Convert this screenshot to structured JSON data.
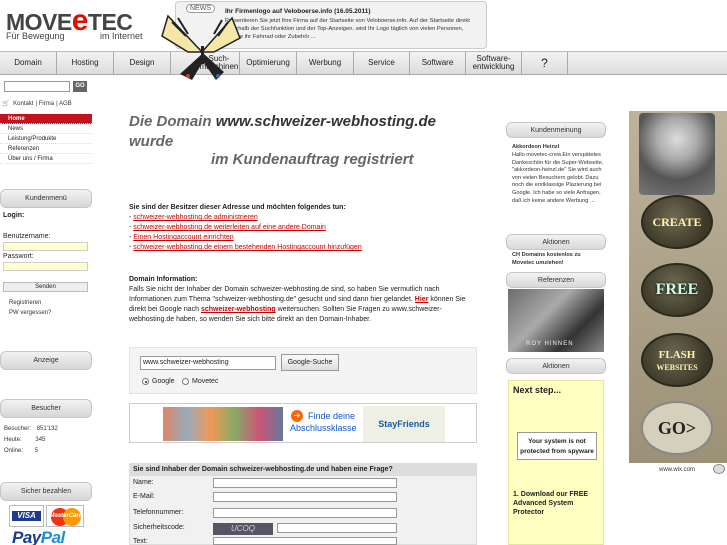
{
  "header": {
    "logo_main": "MOVE",
    "logo_e": "e",
    "logo_tec": "TEC",
    "logo_sub1": "Für Bewegung",
    "logo_sub2": "im Internet",
    "news_badge": "NEWS",
    "news_title": "Ihr Firmenlogo auf Veloboerse.info (16.05.2011)",
    "news_text": "Präsentieren Sie jetzt Ihre Firma auf der Startseite von Veloboerse.info. Auf der Startseite direkt unterhalb der Suchfunktion und der Top-Anzeigen. wird Ihr Logo täglich von vielen Personen, welche ihr Fahrrad oder Zubehör ..."
  },
  "nav": [
    "Domain",
    "Hosting",
    "Design",
    "Such-\nmaschinen",
    "Optimierung",
    "Werbung",
    "Service",
    "Software",
    "Software-\nentwicklung",
    "?"
  ],
  "left": {
    "go_label": "GO",
    "cart_links": [
      "Kontakt",
      "Firma",
      "AGB"
    ],
    "menu": [
      "Home",
      "News",
      "Leistung/Produkte",
      "Referenzen",
      "Über uns / Firma"
    ],
    "kundenmenu_title": "Kundenmenü",
    "login_label": "Login:",
    "username_label": "Benutzername:",
    "password_label": "Passwort:",
    "send_label": "Senden",
    "register_label": "Registrieren",
    "forgot_label": "PW vergessen?",
    "anzeige_title": "Anzeige",
    "besucher_title": "Besucher",
    "stats": [
      {
        "label": "Besucher:",
        "value": "851'132"
      },
      {
        "label": "Heute:",
        "value": "345"
      },
      {
        "label": "Online:",
        "value": "5"
      }
    ],
    "payment_title": "Sicher bezahlen",
    "visa": "VISA",
    "mastercard": "MasterCard",
    "paypal_1": "Pay",
    "paypal_2": "Pal"
  },
  "main": {
    "title_prefix": "Die Domain ",
    "domain": "www.schweizer-webhosting.de",
    "title_suffix": "wurde",
    "title_line2": "im Kundenauftrag registriert",
    "owner_heading": "Sie sind der Besitzer dieser Adresse und möchten folgendes tun:",
    "owner_links": [
      "schweizer-webhosting.de administrieren",
      "schweizer-webhosting.de weiterleiten auf eine andere Domain",
      "Einen Hostingaccount einrichten",
      "schweizer-webhosting.de einem bestehenden Hostingaccount hinzufügen"
    ],
    "info_heading": "Domain Information:",
    "info_text_1": "Falls Sie nicht der Inhaber der Domain schweizer-webhosting.de sind, so haben Sie vermutlich nach Informationen zum Thema \"schweizer-webhosting.de\" gesucht und sind dann hier gelandet. ",
    "info_hier": "Hier",
    "info_text_2": " können Sie direkt bei Google nach ",
    "info_term": "schweizer-webhosting",
    "info_text_3": " weitersuchen. Sollten Sie Fragen zu www.schweizer-webhosting.de haben, so wenden Sie sich bitte direkt an den Domain-Inhaber.",
    "search_value": "www.schweizer-webhosting",
    "search_button": "Google-Suche",
    "radio_google": "Google",
    "radio_movetec": "Movetec",
    "ad_text": "Finde deine Abschlussklasse",
    "ad_logo": "StayFriends",
    "question_heading": "Sie sind Inhaber der Domain schweizer-webhosting.de und haben eine Frage?",
    "form_labels": [
      "Name:",
      "E-Mail:",
      "Telefonnummer:",
      "Sicherheitscode:",
      "Text:"
    ],
    "captcha": "UCOQ"
  },
  "right": {
    "kundenmeinung_title": "Kundenmeinung",
    "km_name": "Akkordeon Heinzl",
    "km_text": "Hallo movetec-crew.Ein verspätetes Dankeschön für die Super-Webseite, \"akkordeon-heinzl.de\" Sie wird auch von vielen Besuchern gelobt. Dazu noch die erstklassige Plazierung bei Google. Ich habe so viele Anfragen, daß ich keine andere Werbung ...",
    "aktionen_title": "Aktionen",
    "aktion_text": "CH Domains kostenlos zu Movetec umziehen!",
    "referenzen_title": "Referenzen",
    "ref_caption": "ROY HINNEN",
    "aktionen2_title": "Aktionen",
    "next_step": "Next step...",
    "sys_text": "Your system is not protected from spyware",
    "dl_text": "1. Download our FREE Advanced System Protector"
  },
  "farad": {
    "create": "CREATE",
    "free": "FREE",
    "flash": "FLASH",
    "websites": "WEBSITES",
    "go": "GO>",
    "wix": "www.wix.com"
  }
}
